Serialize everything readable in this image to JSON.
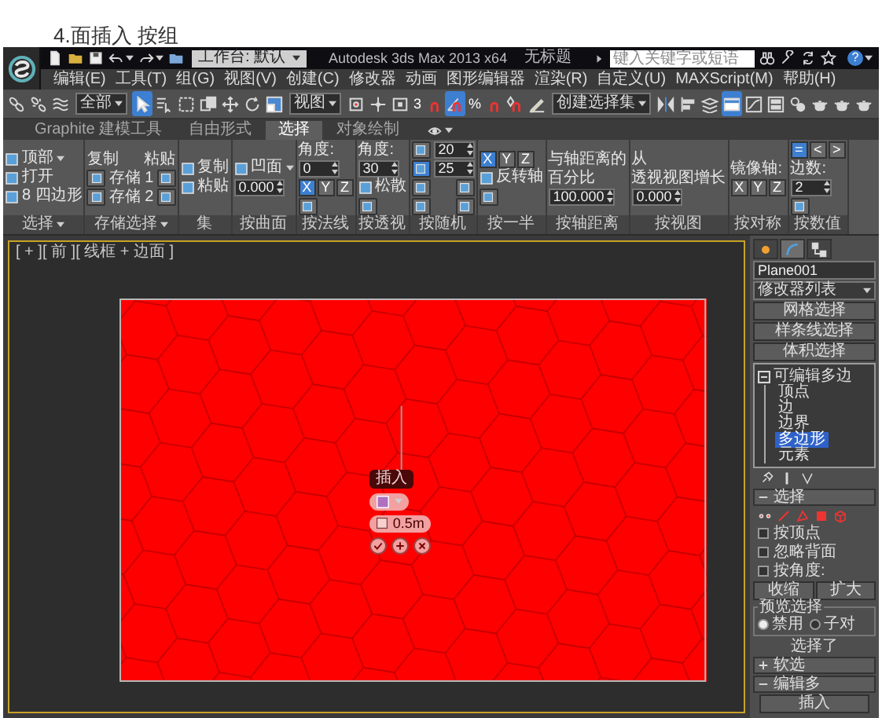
{
  "heading": "4.面插入 按组",
  "titlebar": {
    "workspace": "工作台: 默认",
    "title": "Autodesk 3ds Max 2013 x64",
    "document": "无标题",
    "search": {
      "placeholder": "键入关键字或短语"
    },
    "help": "?"
  },
  "menu": [
    "编辑(E)",
    "工具(T)",
    "组(G)",
    "视图(V)",
    "创建(C)",
    "修改器",
    "动画",
    "图形编辑器",
    "渲染(R)",
    "自定义(U)",
    "MAXScript(M)",
    "帮助(H)"
  ],
  "toolbar": [
    {
      "kind": "button",
      "selected": false
    },
    {
      "kind": "button",
      "selected": false
    },
    {
      "kind": "button",
      "selected": false
    },
    {
      "kind": "dropdown",
      "value": "全部"
    },
    {
      "kind": "button",
      "selected": true
    },
    {
      "kind": "button",
      "selected": false
    },
    {
      "kind": "button",
      "selected": false
    },
    {
      "kind": "button",
      "selected": false
    },
    {
      "kind": "button",
      "selected": false
    },
    {
      "kind": "button",
      "selected": false
    },
    {
      "kind": "button",
      "selected": false
    },
    {
      "kind": "dropdown",
      "value": "视图"
    },
    {
      "kind": "button",
      "selected": false
    },
    {
      "kind": "button",
      "selected": false
    },
    {
      "kind": "button",
      "selected": false
    },
    {
      "kind": "button",
      "selected": false,
      "label": "3"
    },
    {
      "kind": "button",
      "selected": true
    },
    {
      "kind": "button",
      "selected": false,
      "label": "%"
    },
    {
      "kind": "button",
      "selected": false
    },
    {
      "kind": "button",
      "selected": false
    },
    {
      "kind": "dropdown",
      "value": "创建选择集"
    },
    {
      "kind": "button",
      "selected": false
    },
    {
      "kind": "button",
      "selected": false
    },
    {
      "kind": "button",
      "selected": false
    },
    {
      "kind": "button",
      "selected": true
    },
    {
      "kind": "button",
      "selected": false
    },
    {
      "kind": "button",
      "selected": false
    },
    {
      "kind": "button",
      "selected": false
    },
    {
      "kind": "button",
      "selected": false
    },
    {
      "kind": "button",
      "selected": false
    },
    {
      "kind": "button",
      "selected": false
    }
  ],
  "ribbon": {
    "tabs": [
      {
        "label": "Graphite 建模工具",
        "selected": false
      },
      {
        "label": "自由形式",
        "selected": false
      },
      {
        "label": "选择",
        "selected": true
      },
      {
        "label": "对象绘制",
        "selected": false
      }
    ],
    "groups": [
      {
        "label": "选择",
        "menu": true,
        "rows": [
          [
            {
              "kind": "icon_label",
              "label": "顶部",
              "dropdown": true
            }
          ],
          [
            {
              "kind": "icon_label",
              "label": "打开",
              "dropdown": false
            }
          ],
          [
            {
              "kind": "icon_label",
              "label": "8 四边形",
              "dropdown": false
            }
          ]
        ]
      },
      {
        "label": "存储选择",
        "menu": true,
        "rows": [
          [
            {
              "kind": "text",
              "label": "复制"
            },
            {
              "kind": "text",
              "label": "粘贴"
            }
          ],
          [
            {
              "kind": "icon_button",
              "selected": false
            },
            {
              "kind": "text",
              "label": "存储 1"
            },
            {
              "kind": "icon_button",
              "selected": false
            }
          ],
          [
            {
              "kind": "icon_button",
              "selected": false
            },
            {
              "kind": "text",
              "label": "存储 2"
            },
            {
              "kind": "icon_button",
              "selected": false
            }
          ]
        ]
      },
      {
        "label": "集",
        "menu": false,
        "rows": [
          [
            {
              "kind": "icon_label",
              "label": "复制",
              "dropdown": false
            }
          ],
          [
            {
              "kind": "icon_label",
              "label": "粘贴",
              "dropdown": false
            }
          ]
        ]
      },
      {
        "label": "按曲面",
        "menu": false,
        "rows": [
          [
            {
              "kind": "icon_label",
              "label": "凹面",
              "dropdown": true
            }
          ],
          [
            {
              "kind": "field",
              "value": "0.000"
            }
          ]
        ]
      },
      {
        "label": "按法线",
        "menu": false,
        "rows": [
          [
            {
              "kind": "text",
              "label": "角度:"
            }
          ],
          [
            {
              "kind": "field",
              "value": "0"
            }
          ],
          [
            {
              "kind": "axes",
              "buttons": [
                {
                  "label": "X",
                  "selected": true
                },
                {
                  "label": "Y",
                  "selected": false
                },
                {
                  "label": "Z",
                  "selected": false
                }
              ]
            }
          ],
          [
            {
              "kind": "icon_button",
              "selected": false
            }
          ]
        ]
      },
      {
        "label": "按透视",
        "menu": false,
        "rows": [
          [
            {
              "kind": "text",
              "label": "角度:"
            }
          ],
          [
            {
              "kind": "field",
              "value": "30"
            }
          ],
          [
            {
              "kind": "icon_label",
              "label": "松散",
              "dropdown": false
            }
          ],
          [
            {
              "kind": "icon_button",
              "selected": false
            }
          ]
        ]
      },
      {
        "label": "按随机",
        "menu": false,
        "rows": [
          [
            {
              "kind": "icon_button",
              "selected": false
            },
            {
              "kind": "field",
              "value": "20"
            }
          ],
          [
            {
              "kind": "icon_button",
              "selected": true
            },
            {
              "kind": "field",
              "value": "25"
            }
          ],
          [
            {
              "kind": "icon_button",
              "selected": false
            },
            {
              "kind": "icon_button",
              "selected": false
            }
          ],
          [
            {
              "kind": "icon_button",
              "selected": false
            },
            {
              "kind": "icon_button",
              "selected": false
            }
          ]
        ]
      },
      {
        "label": "按一半",
        "menu": false,
        "rows": [
          [
            {
              "kind": "axes",
              "buttons": [
                {
                  "label": "X",
                  "selected": true
                },
                {
                  "label": "Y",
                  "selected": false
                },
                {
                  "label": "Z",
                  "selected": false
                }
              ]
            }
          ],
          [
            {
              "kind": "icon_label",
              "label": "反转轴",
              "dropdown": false
            }
          ],
          [
            {
              "kind": "icon_button",
              "selected": false
            }
          ]
        ]
      },
      {
        "label": "按轴距离",
        "menu": false,
        "rows": [
          [
            {
              "kind": "text",
              "label": "与轴距离的"
            }
          ],
          [
            {
              "kind": "text",
              "label": "百分比"
            }
          ],
          [
            {
              "kind": "field",
              "value": "100.000"
            }
          ]
        ]
      },
      {
        "label": "按视图",
        "menu": false,
        "rows": [
          [
            {
              "kind": "text",
              "label": "从"
            }
          ],
          [
            {
              "kind": "text",
              "label": "透视视图增长"
            }
          ],
          [
            {
              "kind": "field",
              "value": "0.000"
            }
          ]
        ]
      },
      {
        "label": "按对称",
        "menu": false,
        "rows": [
          [
            {
              "kind": "text",
              "label": "镜像轴:"
            }
          ],
          [
            {
              "kind": "axes",
              "buttons": [
                {
                  "label": "X",
                  "selected": false
                },
                {
                  "label": "Y",
                  "selected": false
                },
                {
                  "label": "Z",
                  "selected": false
                }
              ]
            }
          ]
        ]
      },
      {
        "label": "按数值",
        "menu": false,
        "rows": [
          [
            {
              "kind": "axes",
              "buttons": [
                {
                  "label": "=",
                  "selected": true
                },
                {
                  "label": "<",
                  "selected": false
                },
                {
                  "label": ">",
                  "selected": false
                }
              ]
            }
          ],
          [
            {
              "kind": "text",
              "label": "边数:"
            }
          ],
          [
            {
              "kind": "field",
              "value": "2"
            }
          ],
          [
            {
              "kind": "icon_button",
              "selected": false
            }
          ]
        ]
      }
    ]
  },
  "viewport": {
    "label": "[ + ][ 前 ][ 线框 + 边面 ]",
    "caddy": {
      "title": "插入",
      "amount": "0.5m"
    }
  },
  "command_panel": {
    "tabs": [
      {
        "selected": false
      },
      {
        "selected": true
      },
      {
        "selected": false
      }
    ],
    "object_name": "Plane001",
    "modifier_list": "修改器列表",
    "modifier_buttons": [
      "网格选择",
      "样条线选择",
      "体积选择"
    ],
    "stack": [
      {
        "label": "可编辑多边",
        "expanded": true,
        "children": [
          {
            "label": "顶点",
            "selected": false
          },
          {
            "label": "边",
            "selected": false
          },
          {
            "label": "边界",
            "selected": false
          },
          {
            "label": "多边形",
            "selected": true
          },
          {
            "label": "元素",
            "selected": false
          }
        ]
      }
    ],
    "selection_rollout": {
      "title": "选择",
      "expanded": true,
      "checkboxes": [
        {
          "label": "按顶点",
          "checked": false
        },
        {
          "label": "忽略背面",
          "checked": false
        },
        {
          "label": "按角度:",
          "checked": false
        }
      ],
      "buttons": [
        "收缩",
        "扩大"
      ],
      "preview": {
        "title": "预览选择",
        "options": [
          {
            "label": "禁用",
            "selected": true
          },
          {
            "label": "子对",
            "selected": false
          }
        ]
      },
      "status": "选择了"
    },
    "rollouts": [
      {
        "title": "软选",
        "expanded": false
      },
      {
        "title": "编辑多",
        "expanded": true
      }
    ],
    "insert_button": "插入"
  }
}
